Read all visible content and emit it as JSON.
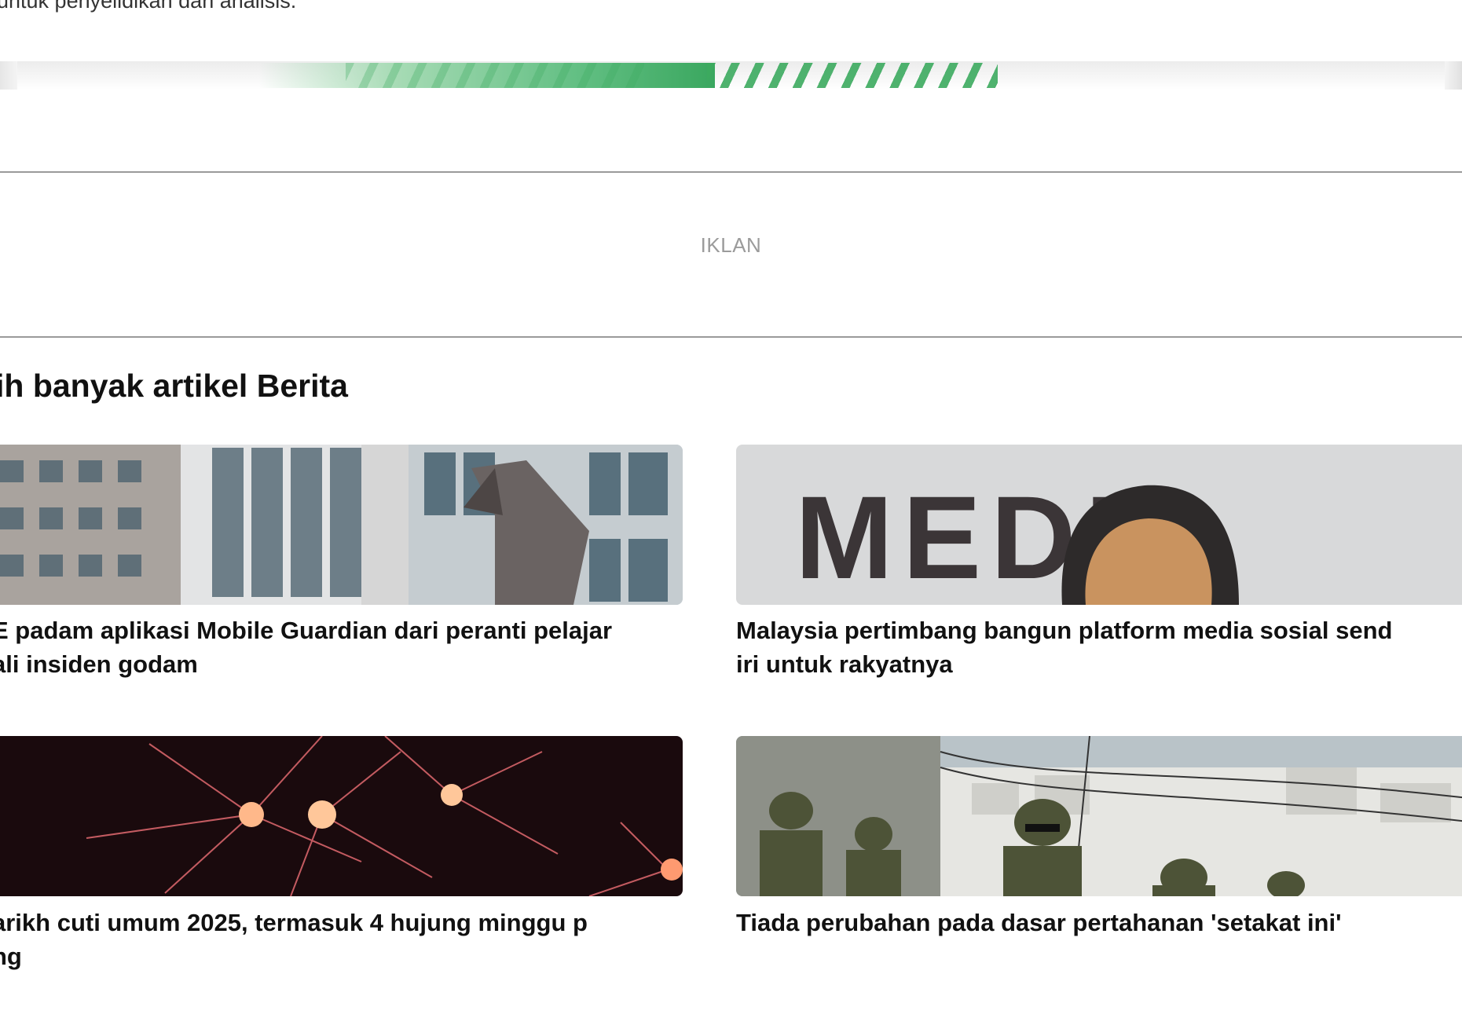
{
  "intro": {
    "text": "untuk penyelidikan dan analisis."
  },
  "progress": {
    "color": "#3aa75f"
  },
  "ad": {
    "label": "IKLAN"
  },
  "section": {
    "title": "ih banyak artikel Berita"
  },
  "articles": [
    {
      "image_alt": "office building",
      "headline_line1": "E padam aplikasi Mobile Guardian dari peranti pelajar",
      "headline_line2": "ali insiden godam"
    },
    {
      "image_alt": "media backdrop speaker",
      "image_text": "MEDIA",
      "headline_line1": "Malaysia pertimbang bangun platform media sosial send",
      "headline_line2": "iri untuk rakyatnya"
    },
    {
      "image_alt": "fireworks",
      "headline_line1": "arikh cuti umum 2025, termasuk 4 hujung minggu p",
      "headline_line2": "ng"
    },
    {
      "image_alt": "soldiers",
      "headline_line1": "Tiada perubahan pada dasar pertahanan 'setakat ini'",
      "headline_line2": ""
    }
  ]
}
